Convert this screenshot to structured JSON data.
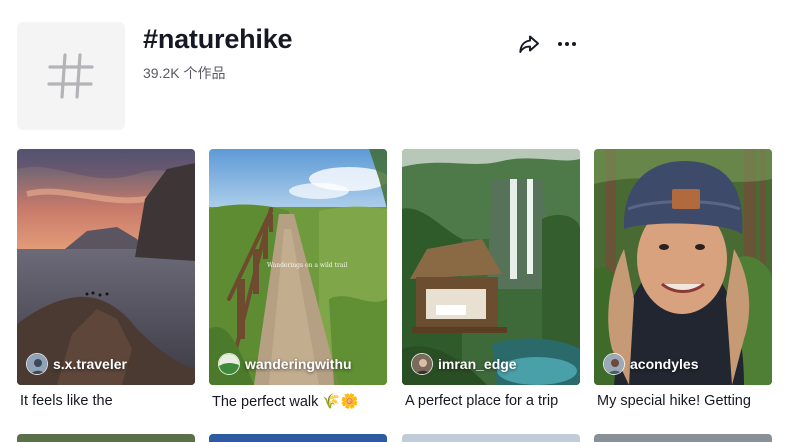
{
  "hashtag": {
    "title": "#naturehike",
    "post_count": "39.2K 个作品"
  },
  "actions": {
    "share_icon": "share-arrow-icon",
    "more_icon": "more-horizontal-icon"
  },
  "videos": [
    {
      "author": "s.x.traveler",
      "caption": "It feels like the"
    },
    {
      "author": "wanderingwithu",
      "caption": "The perfect walk 🌾🌼",
      "overlay": "Wanderings on a wild trail"
    },
    {
      "author": "imran_edge",
      "caption": "A perfect place for a trip"
    },
    {
      "author": "acondyles",
      "caption": "My special hike! Getting"
    }
  ],
  "colors": {
    "text_primary": "#161823",
    "text_secondary": "#5a5b62",
    "avatar_bg": "#f4f4f5"
  }
}
